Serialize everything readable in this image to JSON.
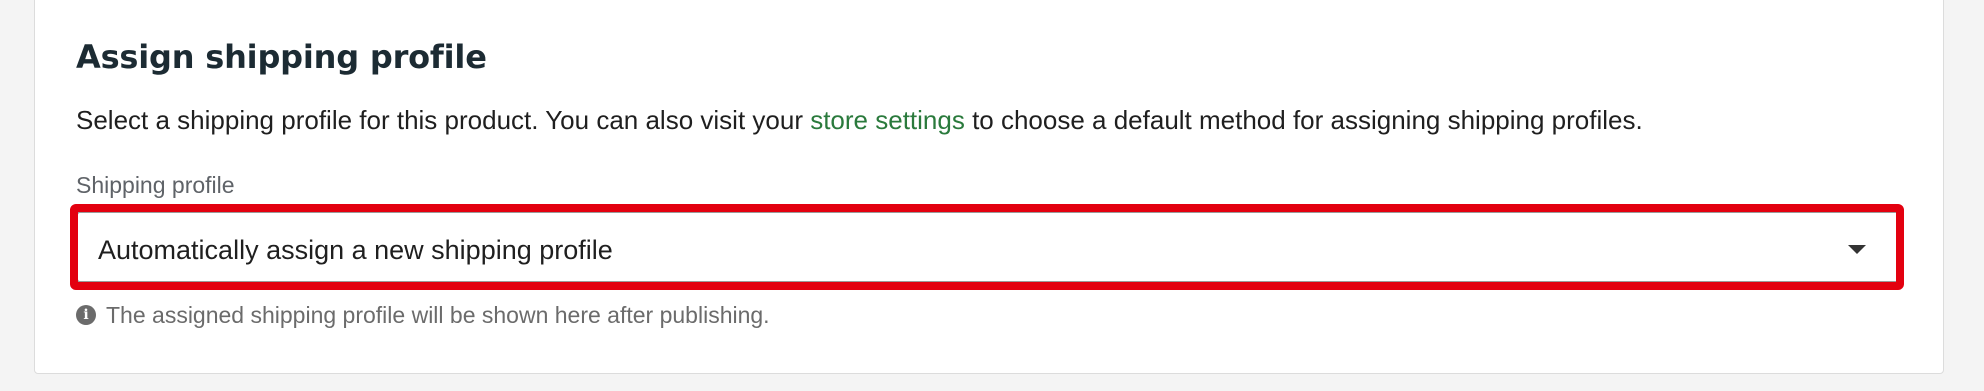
{
  "section": {
    "title": "Assign shipping profile",
    "description_before": "Select a shipping profile for this product. You can also visit your ",
    "description_link": "store settings",
    "description_after": " to choose a default method for assigning shipping profiles."
  },
  "shipping_profile": {
    "label": "Shipping profile",
    "selected_value": "Automatically assign a new shipping profile",
    "dropdown_icon": "chevron-down-icon",
    "help_icon": "info-icon",
    "help_text": "The assigned shipping profile will be shown here after publishing."
  },
  "colors": {
    "link": "#2a7a3c",
    "highlight": "#e3000f"
  }
}
